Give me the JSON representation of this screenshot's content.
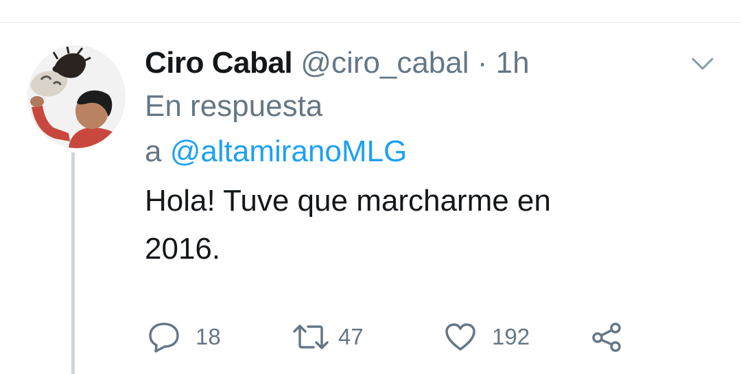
{
  "tweet": {
    "author_name": "Ciro Cabal",
    "author_handle": "@ciro_cabal",
    "separator": "·",
    "time": "1h",
    "reply_prefix": "En respuesta",
    "reply_to_prefix": "a",
    "reply_to_handle": "@altamiranoMLG",
    "text_line1": "Hola! Tuve que marcharme en",
    "text_line2": "2016."
  },
  "actions": {
    "reply_count": "18",
    "retweet_count": "47",
    "like_count": "192"
  },
  "icons": {
    "reply": "speech-bubble-icon",
    "retweet": "retweet-arrows-icon",
    "like": "heart-icon",
    "share": "share-nodes-icon",
    "menu": "chevron-down-icon"
  },
  "colors": {
    "text": "#14171a",
    "secondary": "#657786",
    "link": "#1da1f2",
    "divider": "#e6ecf0",
    "thread_line": "#ccd6dd"
  }
}
